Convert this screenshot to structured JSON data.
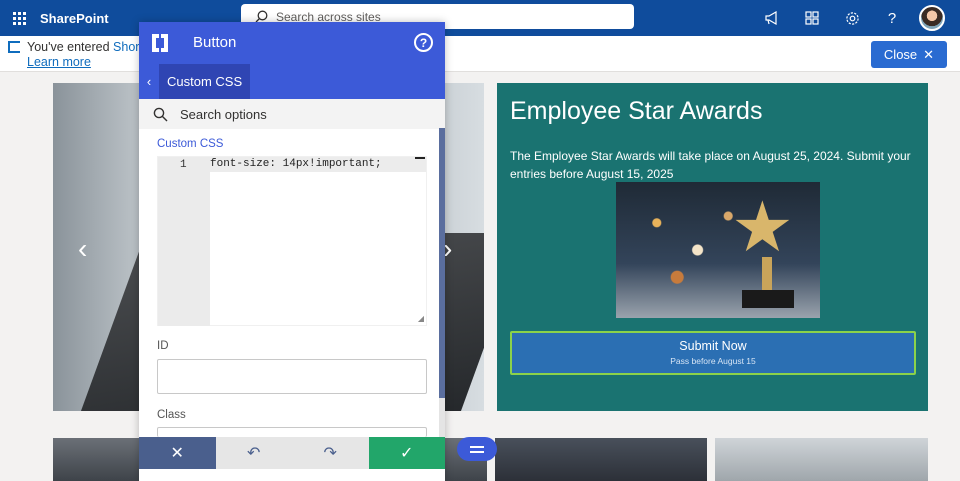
{
  "suitebar": {
    "brand": "SharePoint",
    "search_placeholder": "Search across sites",
    "icons": [
      "megaphone-icon",
      "apps-icon",
      "settings-icon",
      "help-icon",
      "avatar"
    ]
  },
  "notice": {
    "text": "You've entered ",
    "highlight": "Shor",
    "learn_more": "Learn more",
    "close_label": "Close"
  },
  "award": {
    "title": "Employee Star Awards",
    "description": "The Employee Star Awards will take place on August 25, 2024. Submit your entries before August 15, 2025",
    "button_label": "Submit Now",
    "button_sublabel": "Pass before August 15"
  },
  "panel": {
    "title": "Button",
    "breadcrumb": "Custom CSS",
    "search_placeholder": "Search options",
    "fields": {
      "custom_css_label": "Custom CSS",
      "line_number": "1",
      "css_value": "font-size: 14px!important;",
      "id_label": "ID",
      "class_label": "Class"
    },
    "footer": {
      "cancel": "✕",
      "undo": "↶",
      "redo": "↷",
      "confirm": "✓"
    }
  },
  "colors": {
    "suitebar": "#0f4c9c",
    "panel_accent": "#3c5ad8",
    "award_bg": "#1a7371",
    "confirm": "#22a66a"
  }
}
